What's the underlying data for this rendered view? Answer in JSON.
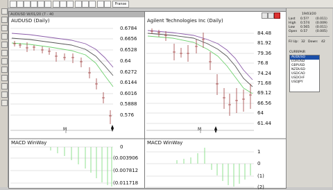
{
  "toolbar": {
    "buttons": [
      "",
      "",
      "",
      "",
      "",
      "",
      "",
      "",
      "",
      "",
      "",
      "",
      "",
      "",
      "Franse"
    ]
  },
  "chart_left": {
    "window_title": "AUDUSD W/01/20 (7 - 40",
    "title": "AUDUSD (Daily)",
    "price_labels": [
      "0.6784",
      "0.6656",
      "0.6528",
      "0.64",
      "0.6272",
      "0.6144",
      "0.6016",
      "0.5888",
      "0.576"
    ],
    "x_label": "M",
    "macd_title": "MACD WinWay",
    "macd_labels": [
      "0",
      "(0.003906",
      "(0.007812",
      "(0.011718"
    ]
  },
  "chart_right": {
    "title": "Agilent Technologies Inc (Daily)",
    "price_labels": [
      "84.48",
      "81.92",
      "79.36",
      "76.8",
      "74.24",
      "71.68",
      "69.12",
      "66.56",
      "64",
      "61.44"
    ],
    "x_label": "M",
    "macd_title": "MACD WinWay",
    "macd_labels": [
      "1",
      "0",
      "(1)",
      "(2)",
      "(3)"
    ]
  },
  "quote_panel": {
    "date": "19/03/20",
    "rows": [
      {
        "k": "Last",
        "v": "0.5??",
        "c": "(0.011)"
      },
      {
        "k": "High",
        "v": "0.574",
        "c": "(0.009)"
      },
      {
        "k": "Low",
        "v": "0.565",
        "c": "(0.011)"
      },
      {
        "k": "Open",
        "v": "0.57",
        "c": "(0.005)"
      }
    ],
    "mid_row": [
      "Fil Up:",
      "32",
      "Down:",
      "42"
    ],
    "list_header": "CURRPAIR",
    "list": [
      "AUDUSD",
      "EURUSD",
      "GBPUSD",
      "NZDUSD",
      "USDCAD",
      "USDCHF",
      "USDJPY"
    ],
    "selected": "AUDUSD"
  },
  "colors": {
    "purple_ma": "#8a5aa8",
    "dark_ma": "#555555",
    "green_ma": "#6fd06f",
    "macd_bar": "#8fe08f",
    "candle": "#c46060",
    "selection": "#1b4fa8"
  }
}
